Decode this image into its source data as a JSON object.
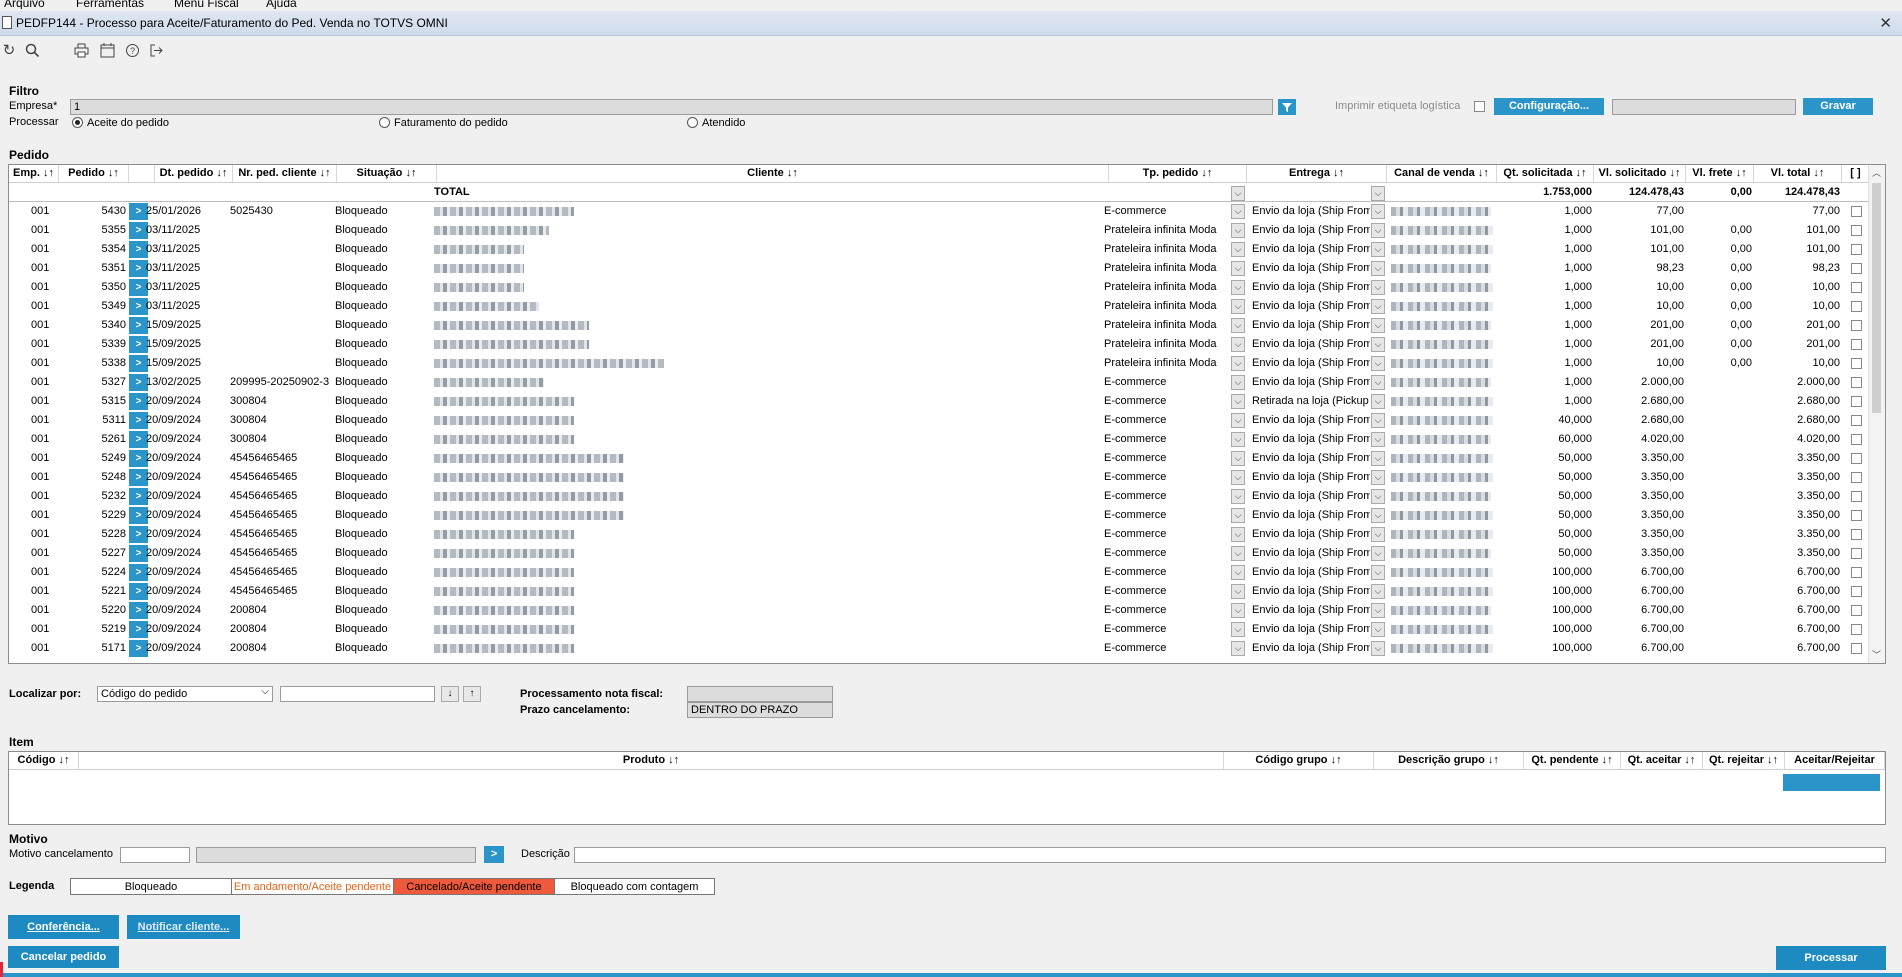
{
  "menu": [
    "Arquivo",
    "Ferramentas",
    "Menu Fiscal",
    "Ajuda"
  ],
  "window_title": "PEDFP144 - Processo para Aceite/Faturamento do Ped. Venda no TOTVS OMNI",
  "filter": {
    "section": "Filtro",
    "empresa_label": "Empresa*",
    "empresa_value": "1",
    "processar_label": "Processar",
    "options": [
      "Aceite do pedido",
      "Faturamento do pedido",
      "Atendido"
    ],
    "selected": "Aceite do pedido",
    "print_label": "Imprimir etiqueta logística",
    "config_button": "Configuração...",
    "save_button": "Gravar"
  },
  "orders": {
    "section": "Pedido",
    "columns": [
      "Emp. ↓↑",
      "Pedido ↓↑",
      "Dt. pedido ↓↑",
      "Nr. ped. cliente ↓↑",
      "Situação ↓↑",
      "Cliente ↓↑",
      "Tp. pedido ↓↑",
      "Entrega ↓↑",
      "Canal de venda ↓↑",
      "Qt. solicitada ↓↑",
      "Vl. solicitado ↓↑",
      "Vl. frete ↓↑",
      "Vl. total ↓↑",
      "[ ]"
    ],
    "total_label": "TOTAL",
    "totals": {
      "qt": "1.753,000",
      "vl_sol": "124.478,43",
      "frete": "0,00",
      "total": "124.478,43"
    },
    "rows": [
      {
        "emp": "001",
        "pedido": "5430",
        "dt": "25/01/2026",
        "nr": "5025430",
        "sit": "Bloqueado",
        "tp": "E-commerce",
        "ent": "Envio da loja (Ship From",
        "qt": "1,000",
        "vl": "77,00",
        "fr": "",
        "tot": "77,00",
        "cw": 140
      },
      {
        "emp": "001",
        "pedido": "5355",
        "dt": "03/11/2025",
        "nr": "",
        "sit": "Bloqueado",
        "tp": "Prateleira infinita Moda",
        "ent": "Envio da loja (Ship From",
        "qt": "1,000",
        "vl": "101,00",
        "fr": "0,00",
        "tot": "101,00",
        "cw": 115
      },
      {
        "emp": "001",
        "pedido": "5354",
        "dt": "03/11/2025",
        "nr": "",
        "sit": "Bloqueado",
        "tp": "Prateleira infinita Moda",
        "ent": "Envio da loja (Ship From",
        "qt": "1,000",
        "vl": "101,00",
        "fr": "0,00",
        "tot": "101,00",
        "cw": 90
      },
      {
        "emp": "001",
        "pedido": "5351",
        "dt": "03/11/2025",
        "nr": "",
        "sit": "Bloqueado",
        "tp": "Prateleira infinita Moda",
        "ent": "Envio da loja (Ship From",
        "qt": "1,000",
        "vl": "98,23",
        "fr": "0,00",
        "tot": "98,23",
        "cw": 90
      },
      {
        "emp": "001",
        "pedido": "5350",
        "dt": "03/11/2025",
        "nr": "",
        "sit": "Bloqueado",
        "tp": "Prateleira infinita Moda",
        "ent": "Envio da loja (Ship From",
        "qt": "1,000",
        "vl": "10,00",
        "fr": "0,00",
        "tot": "10,00",
        "cw": 90
      },
      {
        "emp": "001",
        "pedido": "5349",
        "dt": "03/11/2025",
        "nr": "",
        "sit": "Bloqueado",
        "tp": "Prateleira infinita Moda",
        "ent": "Envio da loja (Ship From",
        "qt": "1,000",
        "vl": "10,00",
        "fr": "0,00",
        "tot": "10,00",
        "cw": 105
      },
      {
        "emp": "001",
        "pedido": "5340",
        "dt": "15/09/2025",
        "nr": "",
        "sit": "Bloqueado",
        "tp": "Prateleira infinita Moda",
        "ent": "Envio da loja (Ship From",
        "qt": "1,000",
        "vl": "201,00",
        "fr": "0,00",
        "tot": "201,00",
        "cw": 155
      },
      {
        "emp": "001",
        "pedido": "5339",
        "dt": "15/09/2025",
        "nr": "",
        "sit": "Bloqueado",
        "tp": "Prateleira infinita Moda",
        "ent": "Envio da loja (Ship From",
        "qt": "1,000",
        "vl": "201,00",
        "fr": "0,00",
        "tot": "201,00",
        "cw": 155
      },
      {
        "emp": "001",
        "pedido": "5338",
        "dt": "15/09/2025",
        "nr": "",
        "sit": "Bloqueado",
        "tp": "Prateleira infinita Moda",
        "ent": "Envio da loja (Ship From",
        "qt": "1,000",
        "vl": "10,00",
        "fr": "0,00",
        "tot": "10,00",
        "cw": 230
      },
      {
        "emp": "001",
        "pedido": "5327",
        "dt": "13/02/2025",
        "nr": "209995-20250902-3",
        "sit": "Bloqueado",
        "tp": "E-commerce",
        "ent": "Envio da loja (Ship From",
        "qt": "1,000",
        "vl": "2.000,00",
        "fr": "",
        "tot": "2.000,00",
        "cw": 110
      },
      {
        "emp": "001",
        "pedido": "5315",
        "dt": "20/09/2024",
        "nr": "300804",
        "sit": "Bloqueado",
        "tp": "E-commerce",
        "ent": "Retirada na loja (Pickup S",
        "qt": "1,000",
        "vl": "2.680,00",
        "fr": "",
        "tot": "2.680,00",
        "cw": 140
      },
      {
        "emp": "001",
        "pedido": "5311",
        "dt": "20/09/2024",
        "nr": "300804",
        "sit": "Bloqueado",
        "tp": "E-commerce",
        "ent": "Envio da loja (Ship From",
        "qt": "40,000",
        "vl": "2.680,00",
        "fr": "",
        "tot": "2.680,00",
        "cw": 140
      },
      {
        "emp": "001",
        "pedido": "5261",
        "dt": "20/09/2024",
        "nr": "300804",
        "sit": "Bloqueado",
        "tp": "E-commerce",
        "ent": "Envio da loja (Ship From",
        "qt": "60,000",
        "vl": "4.020,00",
        "fr": "",
        "tot": "4.020,00",
        "cw": 140
      },
      {
        "emp": "001",
        "pedido": "5249",
        "dt": "20/09/2024",
        "nr": "45456465465",
        "sit": "Bloqueado",
        "tp": "E-commerce",
        "ent": "Envio da loja (Ship From",
        "qt": "50,000",
        "vl": "3.350,00",
        "fr": "",
        "tot": "3.350,00",
        "cw": 190
      },
      {
        "emp": "001",
        "pedido": "5248",
        "dt": "20/09/2024",
        "nr": "45456465465",
        "sit": "Bloqueado",
        "tp": "E-commerce",
        "ent": "Envio da loja (Ship From",
        "qt": "50,000",
        "vl": "3.350,00",
        "fr": "",
        "tot": "3.350,00",
        "cw": 190
      },
      {
        "emp": "001",
        "pedido": "5232",
        "dt": "20/09/2024",
        "nr": "45456465465",
        "sit": "Bloqueado",
        "tp": "E-commerce",
        "ent": "Envio da loja (Ship From",
        "qt": "50,000",
        "vl": "3.350,00",
        "fr": "",
        "tot": "3.350,00",
        "cw": 190
      },
      {
        "emp": "001",
        "pedido": "5229",
        "dt": "20/09/2024",
        "nr": "45456465465",
        "sit": "Bloqueado",
        "tp": "E-commerce",
        "ent": "Envio da loja (Ship From",
        "qt": "50,000",
        "vl": "3.350,00",
        "fr": "",
        "tot": "3.350,00",
        "cw": 190
      },
      {
        "emp": "001",
        "pedido": "5228",
        "dt": "20/09/2024",
        "nr": "45456465465",
        "sit": "Bloqueado",
        "tp": "E-commerce",
        "ent": "Envio da loja (Ship From",
        "qt": "50,000",
        "vl": "3.350,00",
        "fr": "",
        "tot": "3.350,00",
        "cw": 140
      },
      {
        "emp": "001",
        "pedido": "5227",
        "dt": "20/09/2024",
        "nr": "45456465465",
        "sit": "Bloqueado",
        "tp": "E-commerce",
        "ent": "Envio da loja (Ship From",
        "qt": "50,000",
        "vl": "3.350,00",
        "fr": "",
        "tot": "3.350,00",
        "cw": 140
      },
      {
        "emp": "001",
        "pedido": "5224",
        "dt": "20/09/2024",
        "nr": "45456465465",
        "sit": "Bloqueado",
        "tp": "E-commerce",
        "ent": "Envio da loja (Ship From",
        "qt": "100,000",
        "vl": "6.700,00",
        "fr": "",
        "tot": "6.700,00",
        "cw": 140
      },
      {
        "emp": "001",
        "pedido": "5221",
        "dt": "20/09/2024",
        "nr": "45456465465",
        "sit": "Bloqueado",
        "tp": "E-commerce",
        "ent": "Envio da loja (Ship From",
        "qt": "100,000",
        "vl": "6.700,00",
        "fr": "",
        "tot": "6.700,00",
        "cw": 140
      },
      {
        "emp": "001",
        "pedido": "5220",
        "dt": "20/09/2024",
        "nr": "200804",
        "sit": "Bloqueado",
        "tp": "E-commerce",
        "ent": "Envio da loja (Ship From",
        "qt": "100,000",
        "vl": "6.700,00",
        "fr": "",
        "tot": "6.700,00",
        "cw": 140
      },
      {
        "emp": "001",
        "pedido": "5219",
        "dt": "20/09/2024",
        "nr": "200804",
        "sit": "Bloqueado",
        "tp": "E-commerce",
        "ent": "Envio da loja (Ship From",
        "qt": "100,000",
        "vl": "6.700,00",
        "fr": "",
        "tot": "6.700,00",
        "cw": 140
      },
      {
        "emp": "001",
        "pedido": "5171",
        "dt": "20/09/2024",
        "nr": "200804",
        "sit": "Bloqueado",
        "tp": "E-commerce",
        "ent": "Envio da loja (Ship From",
        "qt": "100,000",
        "vl": "6.700,00",
        "fr": "",
        "tot": "6.700,00",
        "cw": 140
      }
    ]
  },
  "locate": {
    "label": "Localizar por:",
    "select_value": "Código do pedido",
    "search_value": "",
    "proc_label": "Processamento nota fiscal:",
    "proc_value": "",
    "prazo_label": "Prazo cancelamento:",
    "prazo_value": "DENTRO DO PRAZO"
  },
  "item": {
    "section": "Item",
    "columns": [
      "Código ↓↑",
      "Produto ↓↑",
      "Código grupo ↓↑",
      "Descrição grupo ↓↑",
      "Qt. pendente ↓↑",
      "Qt. aceitar ↓↑",
      "Qt. rejeitar ↓↑",
      "Aceitar/Rejeitar"
    ]
  },
  "motivo": {
    "section": "Motivo",
    "label": "Motivo cancelamento",
    "desc_label": "Descrição",
    "go_button": ">"
  },
  "legend": {
    "label": "Legenda",
    "items": [
      "Bloqueado",
      "Em andamento/Aceite pendente",
      "Cancelado/Aceite pendente",
      "Bloqueado com contagem"
    ],
    "colors": [
      "#000000",
      "#e0641b",
      "#000000",
      "#000000"
    ]
  },
  "buttons": {
    "conferencia": "Conferência...",
    "notificar": "Notificar cliente...",
    "cancelar": "Cancelar pedido",
    "processar": "Processar"
  }
}
